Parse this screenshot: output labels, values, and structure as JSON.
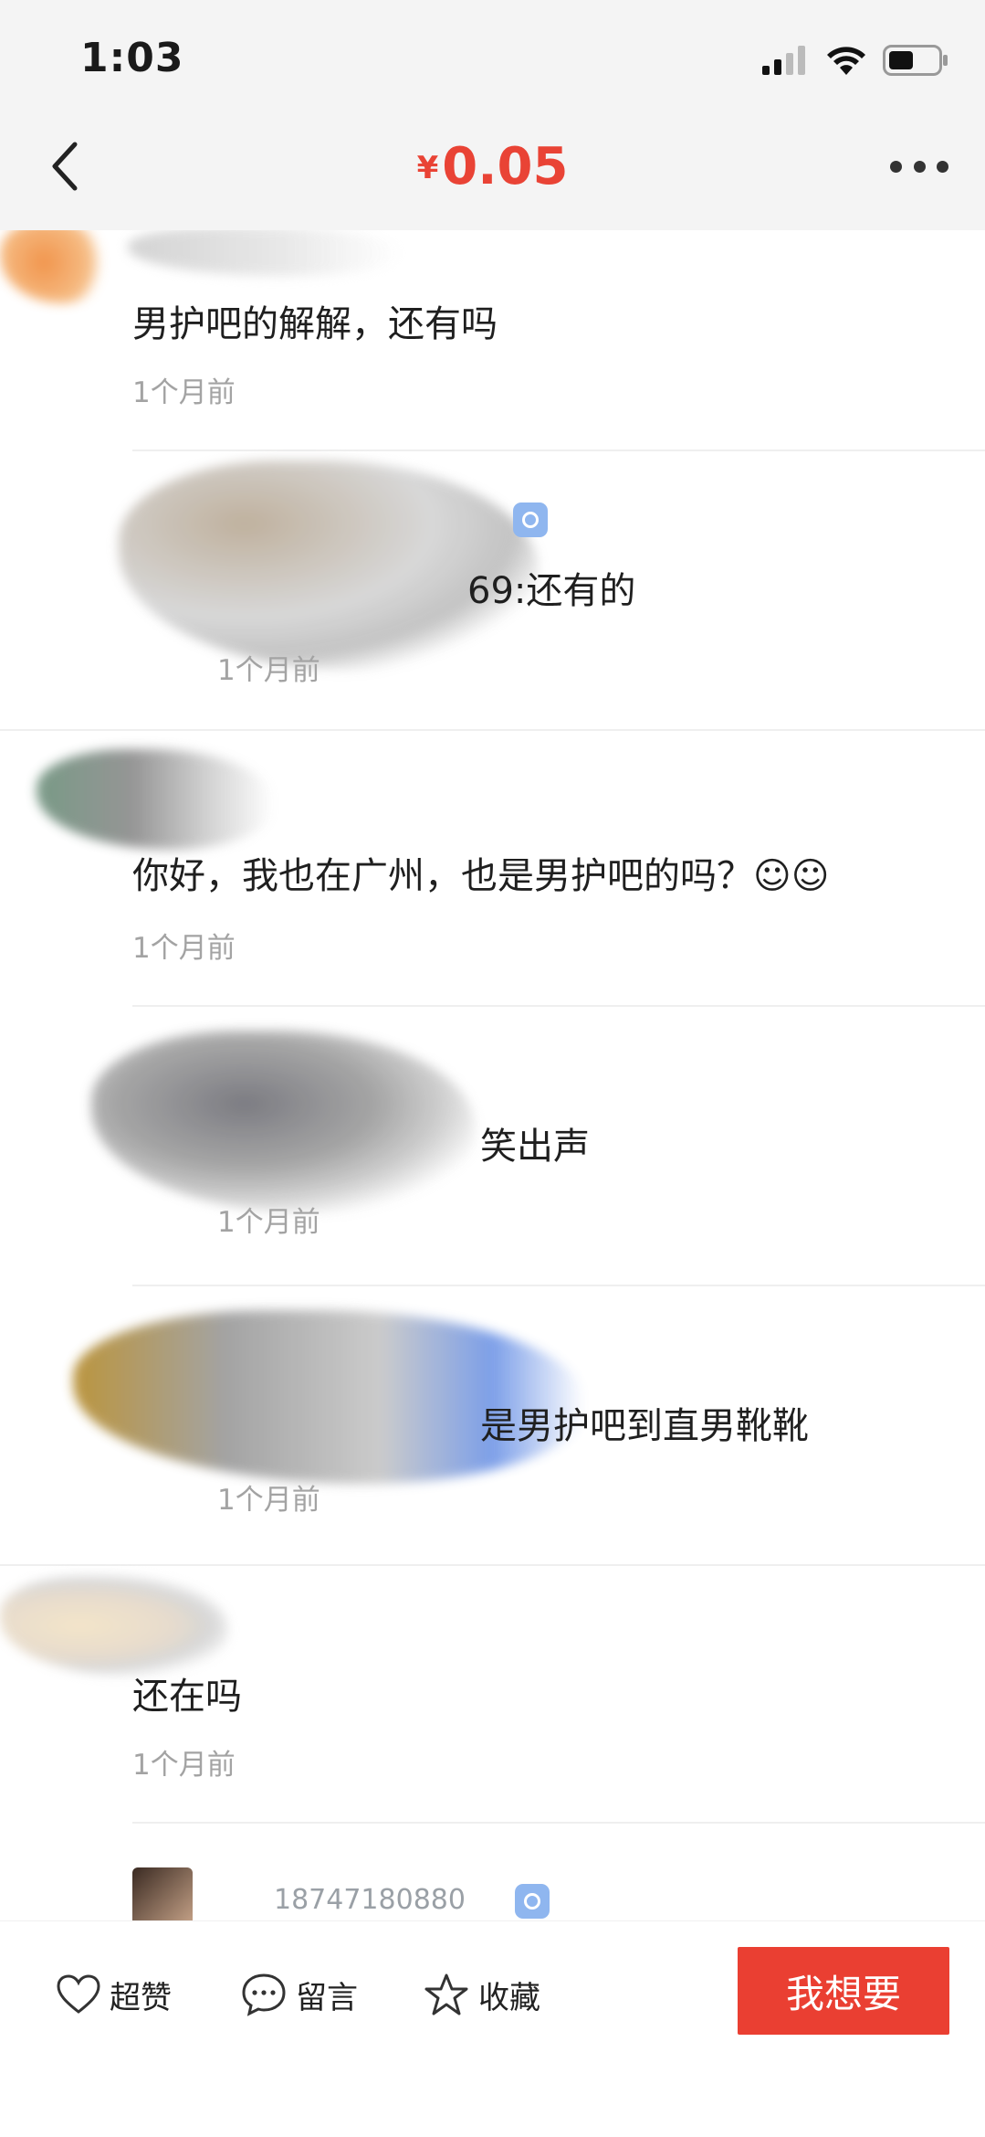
{
  "status_bar": {
    "time": "1:03"
  },
  "header": {
    "currency_symbol": "¥",
    "price": "0.05"
  },
  "comments": [
    {
      "username": "",
      "text": "男护吧的解解，还有吗",
      "time": "1个月前"
    },
    {
      "username": "",
      "text": "69:还有的",
      "time": "1个月前"
    },
    {
      "username": "",
      "text": "你好，我也在广州，也是男护吧的吗？☺☺",
      "time": "1个月前"
    },
    {
      "username": "",
      "text": "笑出声",
      "time": "1个月前"
    },
    {
      "username": "",
      "text": "是男护吧到直男靴靴",
      "time": "1个月前"
    },
    {
      "username": "",
      "text": "还在吗",
      "time": "1个月前"
    }
  ],
  "partial_username": "18747180880",
  "bottom_bar": {
    "like_label": "超赞",
    "comment_label": "留言",
    "favorite_label": "收藏",
    "want_label": "我想要"
  },
  "colors": {
    "accent": "#e94335",
    "button": "#ea3f32",
    "badge": "#8fb6ef"
  },
  "icons": [
    "back-chevron-icon",
    "more-dots-icon",
    "signal-icon",
    "wifi-icon",
    "battery-icon",
    "heart-icon",
    "chat-bubble-icon",
    "star-icon",
    "verified-badge-icon"
  ]
}
